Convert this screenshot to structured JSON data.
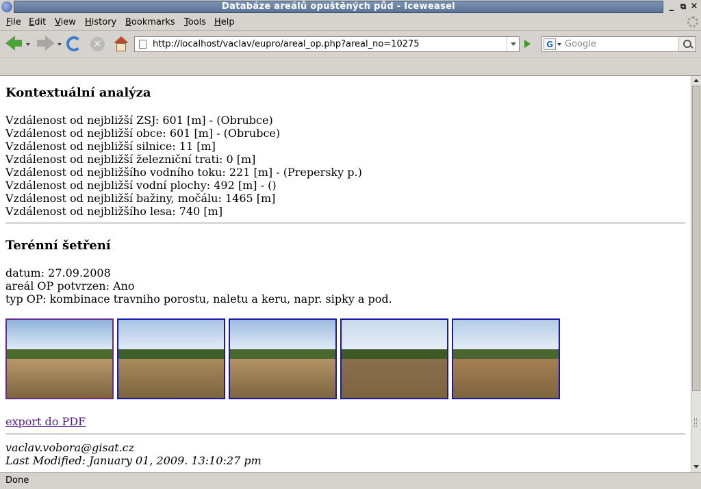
{
  "window": {
    "title": "Databáze areálů opuštěných půd - Iceweasel"
  },
  "menu": [
    {
      "label": "File",
      "accel": "F",
      "rest": "ile"
    },
    {
      "label": "Edit",
      "accel": "E",
      "rest": "dit"
    },
    {
      "label": "View",
      "accel": "V",
      "rest": "iew"
    },
    {
      "label": "History",
      "accel": "H",
      "rest": "istory"
    },
    {
      "label": "Bookmarks",
      "accel": "B",
      "rest": "ookmarks"
    },
    {
      "label": "Tools",
      "accel": "T",
      "rest": "ools"
    },
    {
      "label": "Help",
      "accel": "H",
      "rest": "elp"
    }
  ],
  "toolbar": {
    "url": "http://localhost/vaclav/eupro/areal_op.php?areal_no=10275",
    "search_engine_glyph": "G",
    "search_placeholder": "Google"
  },
  "content": {
    "section1": {
      "heading": "Kontextuální analýza",
      "lines": [
        "Vzdálenost od nejbližší ZSJ: 601 [m] - (Obrubce)",
        "Vzdálenost od nejbližší obce: 601 [m] - (Obrubce)",
        "Vzdálenost od nejbližší silnice: 11 [m]",
        "Vzdálenost od nejbližší železniční trati: 0 [m]",
        "Vzdálenost od nejbližšího vodního toku: 221 [m] - (Prepersky p.)",
        "Vzdálenost od nejbližší vodní plochy: 492 [m] - ()",
        "Vzdálenost od nejbližší bažiny, močálu: 1465 [m]",
        "Vzdálenost od nejbližšího lesa: 740 [m]"
      ]
    },
    "section2": {
      "heading": "Terénní šetření",
      "lines": [
        "datum: 27.09.2008",
        "areál OP potvrzen: Ano",
        "typ OP: kombinace travniho porostu, naletu a keru, napr. sipky a pod."
      ]
    },
    "photos": [
      {
        "sky": "#8fb3dd",
        "trees": "#4c6a2e",
        "field": "#b9986a",
        "visited": true
      },
      {
        "sky": "#a9c4e4",
        "trees": "#3f5f2a",
        "field": "#a88a5c",
        "visited": false
      },
      {
        "sky": "#9dbde2",
        "trees": "#4a6830",
        "field": "#b49466",
        "visited": false
      },
      {
        "sky": "#c8d9ec",
        "trees": "#3d5a26",
        "field": "#8a6e4e",
        "visited": false
      },
      {
        "sky": "#b3cbe6",
        "trees": "#4a6530",
        "field": "#a57f52",
        "visited": false
      }
    ],
    "pdf_link": "export do PDF",
    "email": "vaclav.vobora@gisat.cz",
    "last_modified": "Last Modified: January 01, 2009. 13:10:27 pm"
  },
  "status": {
    "text": "Done"
  }
}
